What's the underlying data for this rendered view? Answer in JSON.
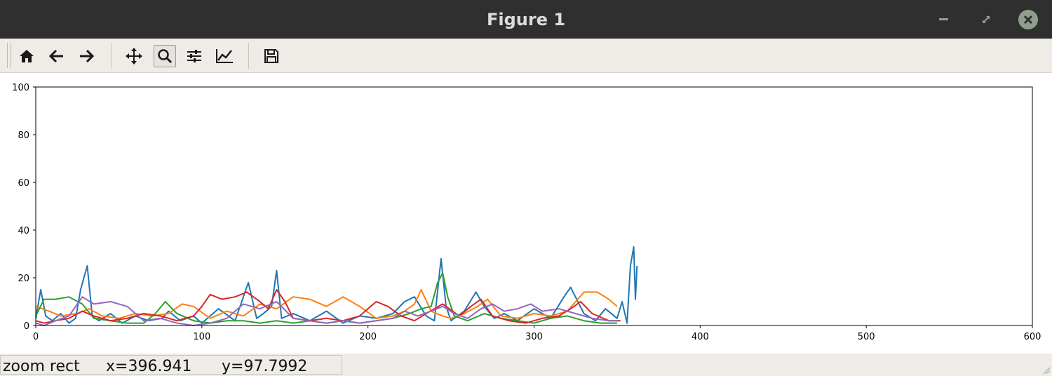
{
  "window": {
    "title": "Figure 1"
  },
  "toolbar": {
    "buttons": [
      {
        "name": "home-button",
        "icon": "home-icon"
      },
      {
        "name": "back-button",
        "icon": "arrow-left-icon"
      },
      {
        "name": "forward-button",
        "icon": "arrow-right-icon"
      },
      {
        "name": "pan-button",
        "icon": "move-icon"
      },
      {
        "name": "zoom-button",
        "icon": "magnifier-icon",
        "active": true
      },
      {
        "name": "configure-subplots-button",
        "icon": "sliders-icon"
      },
      {
        "name": "edit-axes-button",
        "icon": "line-chart-icon"
      },
      {
        "name": "save-button",
        "icon": "floppy-disk-icon"
      }
    ]
  },
  "status": {
    "mode": "zoom rect",
    "x": "x=396.941",
    "y": "y=97.7992"
  },
  "chart_data": {
    "type": "line",
    "title": "",
    "xlabel": "",
    "ylabel": "",
    "xlim": [
      0,
      600
    ],
    "ylim": [
      0,
      100
    ],
    "xticks": [
      0,
      100,
      200,
      300,
      400,
      500,
      600
    ],
    "yticks": [
      0,
      20,
      40,
      60,
      80,
      100
    ],
    "grid": false,
    "series": [
      {
        "color": "#1f77b4",
        "x": [
          0,
          3,
          6,
          10,
          15,
          20,
          24,
          27,
          31,
          34,
          38,
          45,
          52,
          60,
          68,
          76,
          80,
          87,
          95,
          100,
          110,
          120,
          128,
          133,
          137,
          142,
          145,
          148,
          155,
          165,
          175,
          185,
          195,
          205,
          215,
          222,
          228,
          235,
          240,
          244,
          247,
          250,
          258,
          265,
          270,
          276,
          282,
          290,
          300,
          310,
          318,
          322,
          330,
          337,
          343,
          350,
          353,
          356,
          358,
          360,
          361,
          362
        ],
        "y": [
          3,
          15,
          4,
          2,
          5,
          1,
          3,
          15,
          25,
          4,
          2,
          5,
          1,
          4,
          2,
          3,
          6,
          2,
          4,
          1,
          7,
          2,
          18,
          3,
          5,
          8,
          23,
          3,
          5,
          2,
          6,
          1,
          4,
          3,
          5,
          10,
          12,
          4,
          2,
          28,
          8,
          2,
          6,
          14,
          8,
          3,
          5,
          2,
          7,
          3,
          12,
          16,
          5,
          2,
          7,
          3,
          10,
          1,
          25,
          33,
          11,
          25
        ]
      },
      {
        "color": "#ff7f0e",
        "x": [
          0,
          8,
          15,
          25,
          32,
          40,
          50,
          60,
          70,
          80,
          88,
          95,
          105,
          115,
          125,
          135,
          145,
          155,
          165,
          175,
          185,
          195,
          205,
          215,
          222,
          228,
          232,
          238,
          245,
          250,
          258,
          266,
          272,
          280,
          290,
          300,
          310,
          320,
          330,
          338,
          345,
          350
        ],
        "y": [
          8,
          6,
          4,
          5,
          7,
          4,
          3,
          5,
          4,
          5,
          9,
          8,
          3,
          6,
          4,
          9,
          7,
          12,
          11,
          8,
          12,
          8,
          3,
          4,
          6,
          9,
          15,
          6,
          4,
          3,
          5,
          8,
          11,
          4,
          3,
          5,
          4,
          6,
          14,
          14,
          11,
          8
        ]
      },
      {
        "color": "#2ca02c",
        "x": [
          0,
          5,
          12,
          20,
          28,
          35,
          45,
          55,
          65,
          72,
          78,
          85,
          95,
          105,
          115,
          125,
          135,
          145,
          155,
          165,
          175,
          185,
          195,
          205,
          215,
          225,
          232,
          238,
          242,
          245,
          248,
          252,
          260,
          270,
          280,
          290,
          300,
          310,
          320,
          330,
          340,
          350
        ],
        "y": [
          4,
          11,
          11,
          12,
          9,
          3,
          2,
          1,
          1,
          5,
          10,
          5,
          2,
          1,
          2,
          2,
          1,
          2,
          1,
          2,
          1,
          2,
          1,
          2,
          3,
          5,
          7,
          8,
          18,
          22,
          12,
          4,
          2,
          5,
          3,
          2,
          1,
          3,
          4,
          2,
          1,
          1
        ]
      },
      {
        "color": "#d62728",
        "x": [
          0,
          5,
          12,
          20,
          28,
          35,
          45,
          55,
          65,
          75,
          85,
          95,
          100,
          105,
          112,
          120,
          127,
          135,
          140,
          145,
          150,
          155,
          165,
          175,
          185,
          195,
          205,
          212,
          220,
          228,
          235,
          245,
          255,
          262,
          268,
          275,
          285,
          295,
          305,
          315,
          322,
          328,
          335,
          345,
          352
        ],
        "y": [
          2,
          1,
          2,
          3,
          6,
          4,
          2,
          3,
          5,
          4,
          2,
          4,
          8,
          13,
          11,
          12,
          14,
          10,
          7,
          15,
          10,
          3,
          2,
          3,
          2,
          4,
          10,
          8,
          4,
          2,
          5,
          9,
          4,
          8,
          11,
          4,
          2,
          1,
          3,
          4,
          7,
          10,
          5,
          2,
          2
        ]
      },
      {
        "color": "#9467bd",
        "x": [
          0,
          5,
          12,
          20,
          28,
          35,
          45,
          55,
          65,
          75,
          85,
          95,
          105,
          115,
          125,
          135,
          145,
          155,
          165,
          175,
          185,
          195,
          205,
          215,
          222,
          230,
          238,
          245,
          252,
          260,
          268,
          275,
          282,
          290,
          298,
          305,
          315,
          325,
          335,
          345,
          350
        ],
        "y": [
          1,
          0,
          2,
          4,
          12,
          9,
          10,
          8,
          2,
          3,
          1,
          0,
          1,
          3,
          9,
          7,
          10,
          3,
          2,
          1,
          2,
          1,
          2,
          3,
          6,
          4,
          6,
          8,
          5,
          3,
          7,
          9,
          6,
          7,
          9,
          6,
          7,
          5,
          3,
          2,
          2
        ]
      }
    ]
  }
}
